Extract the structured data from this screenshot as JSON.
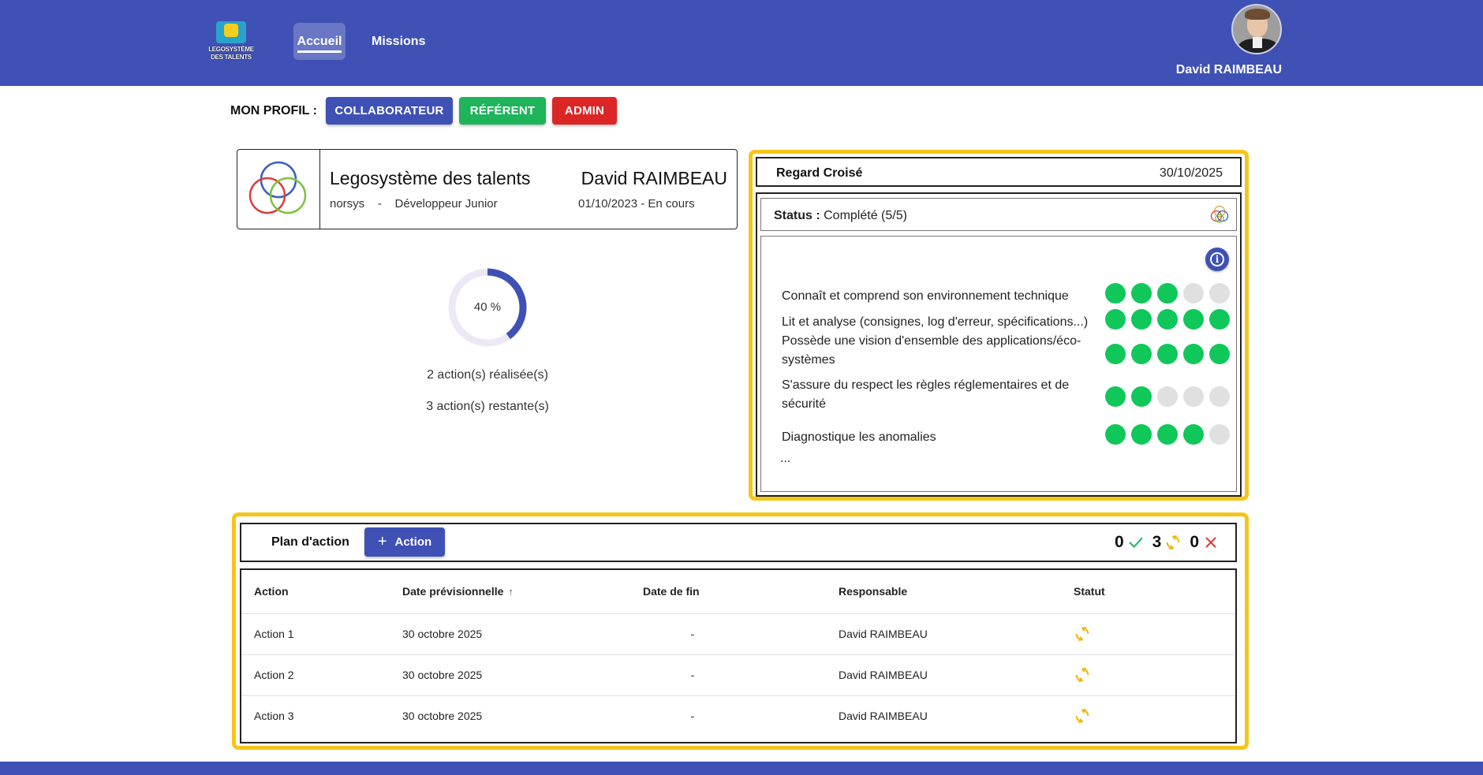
{
  "app": {
    "logo_line1": "LEGOSYSTÈME",
    "logo_line2": "DES TALENTS"
  },
  "nav": {
    "items": [
      {
        "label": "Accueil",
        "active": true
      },
      {
        "label": "Missions",
        "active": false
      }
    ]
  },
  "user": {
    "name": "David RAIMBEAU"
  },
  "profile": {
    "label": "MON PROFIL :",
    "roles": [
      {
        "label": "COLLABORATEUR",
        "color": "#3f51b5"
      },
      {
        "label": "RÉFÉRENT",
        "color": "#1eb45a"
      },
      {
        "label": "ADMIN",
        "color": "#dc2626"
      }
    ]
  },
  "mission": {
    "title": "Legosystème des talents",
    "company": "norsys",
    "separator": "-",
    "role": "Développeur Junior",
    "person": "David RAIMBEAU",
    "start_date": "01/10/2023",
    "state": "En cours",
    "dates_text": "01/10/2023 - En cours"
  },
  "progress": {
    "percent": 40,
    "label": "40 %",
    "done_text": "2 action(s) réalisée(s)",
    "remaining_text": "3 action(s) restante(s)",
    "color": "#3f51b5",
    "track_color": "#ece8f6"
  },
  "regard": {
    "title": "Regard Croisé",
    "date": "30/10/2025",
    "status_label": "Status :",
    "status_value": "Complété (5/5)",
    "skills": [
      {
        "label": "Connaît et comprend son environnement technique",
        "score": 3,
        "max": 5
      },
      {
        "label": "Lit et analyse (consignes, log d'erreur, spécifications...)",
        "score": 5,
        "max": 5
      },
      {
        "label": "Possède une vision d'ensemble des applications/éco-systèmes",
        "score": 5,
        "max": 5
      },
      {
        "label": "S'assure du respect les règles réglementaires et de sécurité",
        "score": 2,
        "max": 5
      },
      {
        "label": "Diagnostique les anomalies",
        "score": 4,
        "max": 5
      }
    ],
    "more": "...",
    "dot_on_color": "#10c75a",
    "dot_off_color": "#e0e0e0"
  },
  "plan": {
    "title": "Plan d'action",
    "add_button": "Action",
    "counts": {
      "done": "0",
      "in_progress": "3",
      "failed": "0"
    },
    "columns": [
      "Action",
      "Date prévisionnelle",
      "Date de fin",
      "Responsable",
      "Statut"
    ],
    "rows": [
      {
        "action": "Action 1",
        "date_prev": "30 octobre 2025",
        "date_fin": "-",
        "responsable": "David RAIMBEAU",
        "statut": "in-progress-icon"
      },
      {
        "action": "Action 2",
        "date_prev": "30 octobre 2025",
        "date_fin": "-",
        "responsable": "David RAIMBEAU",
        "statut": "in-progress-icon"
      },
      {
        "action": "Action 3",
        "date_prev": "30 octobre 2025",
        "date_fin": "-",
        "responsable": "David RAIMBEAU",
        "statut": "in-progress-icon"
      }
    ],
    "accent": "#f5c518"
  }
}
